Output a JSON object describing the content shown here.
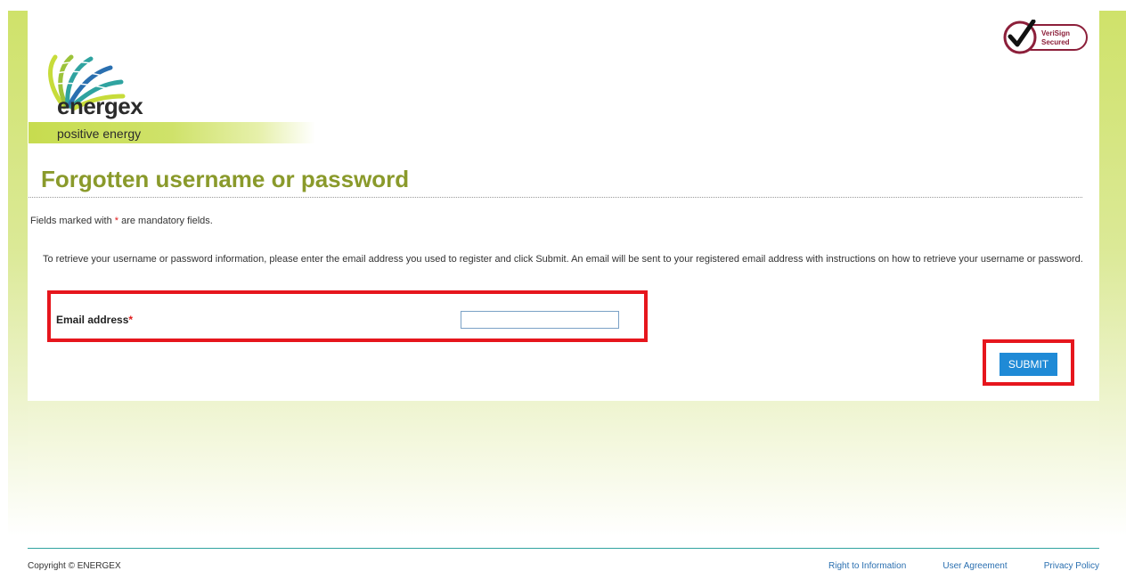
{
  "brand": {
    "name": "energex",
    "tagline": "positive energy",
    "colors": {
      "accent": "#8a9a2b",
      "lime": "#cfe26a",
      "button": "#1f8ad6",
      "highlight": "#e6161d"
    }
  },
  "seal": {
    "icon": "verisign-secured-checkmark-icon",
    "line1": "VeriSign",
    "line2": "Secured"
  },
  "page": {
    "title": "Forgotten username or password",
    "mandatory_prefix": "Fields marked with ",
    "mandatory_star": "*",
    "mandatory_suffix": " are mandatory fields.",
    "instructions": "To retrieve your username or password information, please enter the email address you used to register and click Submit. An email will be sent to your registered email address with instructions on how to retrieve your username or password."
  },
  "form": {
    "email_label": "Email address",
    "email_required_mark": "*",
    "email_value": "",
    "submit_label": "SUBMIT"
  },
  "footer": {
    "copyright": "Copyright © ENERGEX",
    "links": [
      "Right to Information",
      "User Agreement",
      "Privacy Policy"
    ]
  }
}
